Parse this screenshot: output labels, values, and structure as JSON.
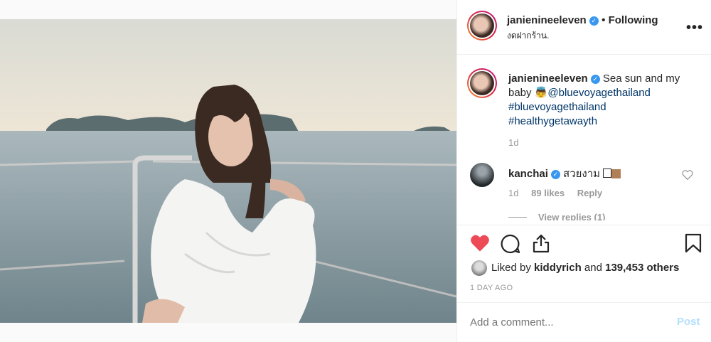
{
  "header": {
    "username": "janienineeleven",
    "follow_status": "Following",
    "location": "งดฝากร้าน."
  },
  "caption": {
    "username": "janienineeleven",
    "text_before": "Sea sun and my baby",
    "emoji": "👼",
    "mention": "@bluevoyagethailand",
    "hashtag1": "#bluevoyagethailand",
    "hashtag2": "#healthygetawayth",
    "time": "1d"
  },
  "comment": {
    "username": "kanchai",
    "text": "สวยงาม",
    "time": "1d",
    "likes": "89 likes",
    "reply_label": "Reply",
    "view_replies": "View replies (1)"
  },
  "likes": {
    "prefix": "Liked by",
    "user": "kiddyrich",
    "joiner": "and",
    "count": "139,453 others"
  },
  "timestamp": "1 DAY AGO",
  "add_comment": {
    "placeholder": "Add a comment...",
    "post_label": "Post"
  },
  "colors": {
    "heart": "#ed4956",
    "verified": "#3897f0",
    "link": "#003569",
    "post_disabled": "#b2dffc"
  }
}
